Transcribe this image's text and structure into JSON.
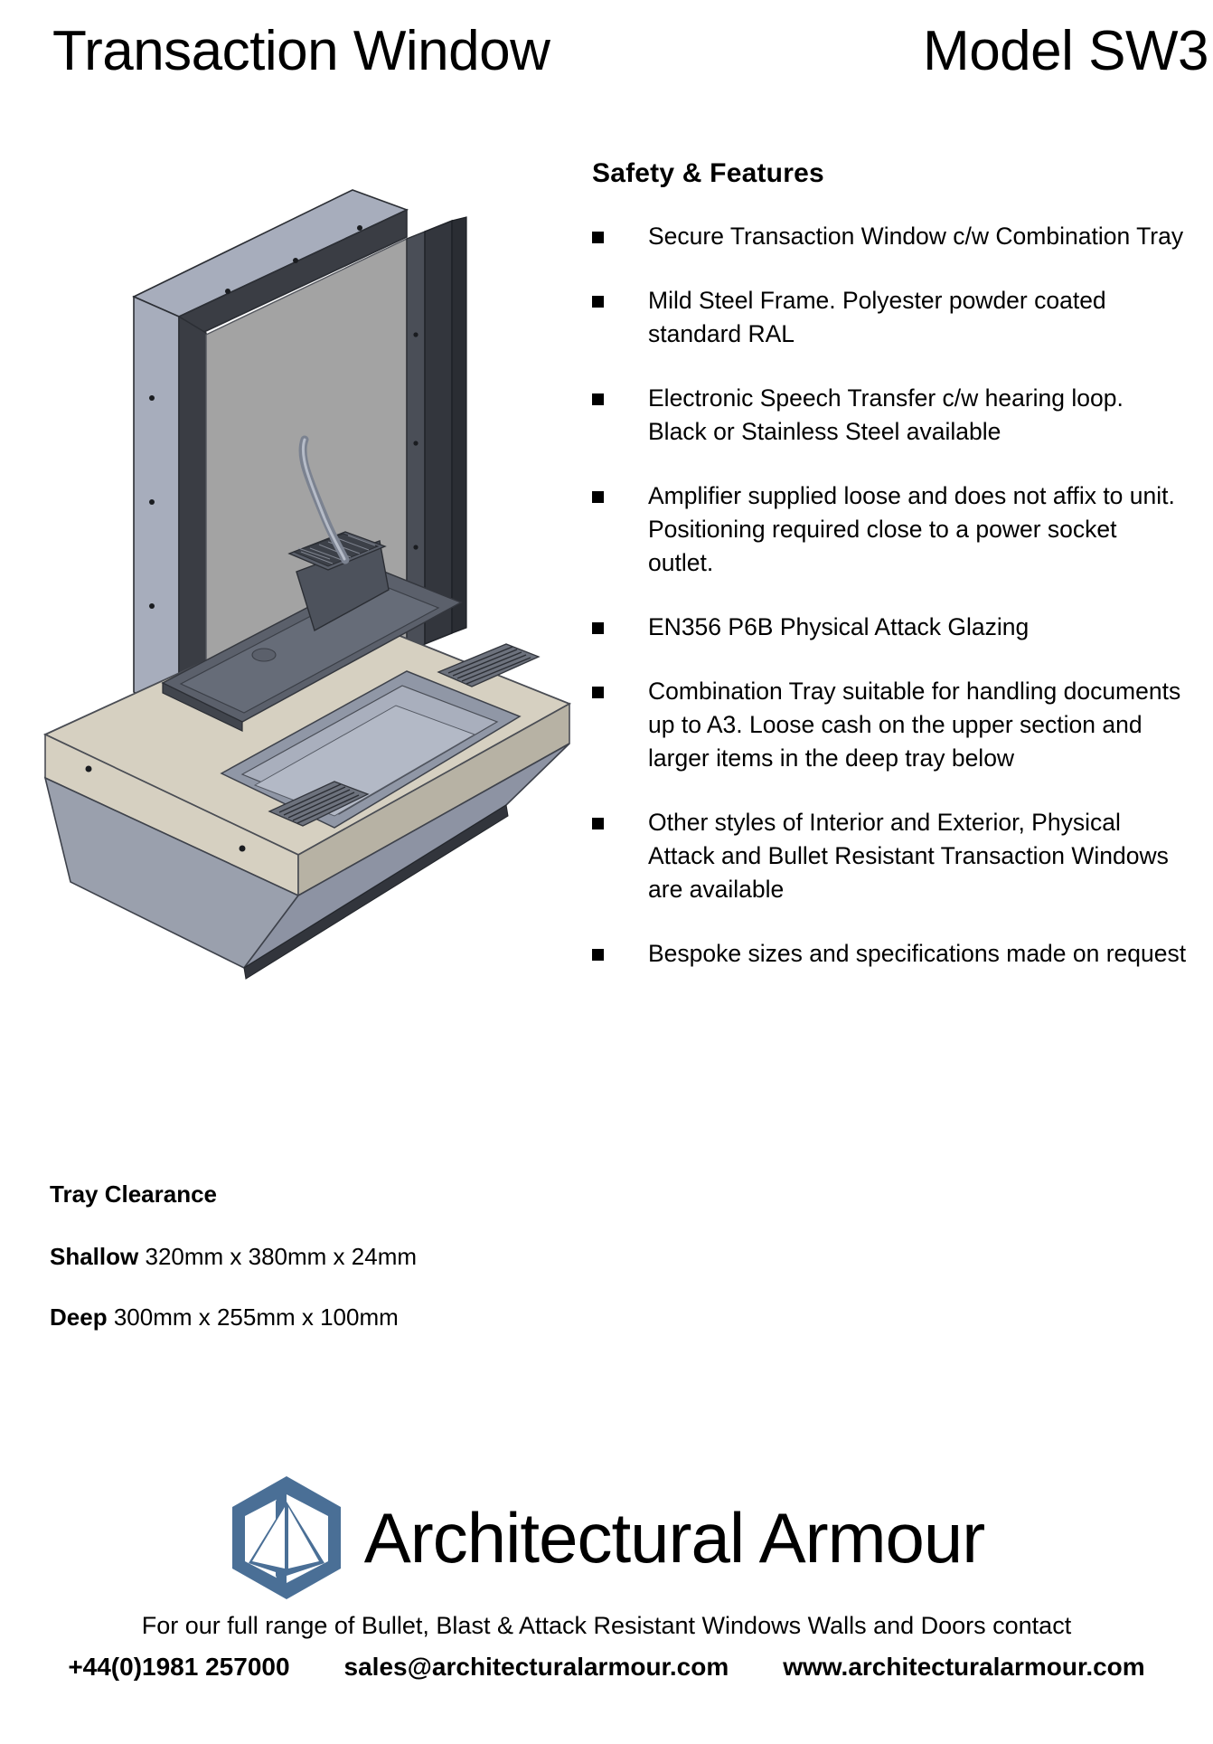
{
  "header": {
    "title": "Transaction Window",
    "model": "Model SW3"
  },
  "product_image": {
    "alt": "Isometric CAD render of Model SW3 secure transaction window with combination tray",
    "colors": {
      "frame_dark": "#3a3d44",
      "frame_light": "#a7adbc",
      "glass": "#a3a3a3",
      "counter_beige": "#d6d0c1",
      "tray_metal": "#8d93a3",
      "tray_dark": "#585d69",
      "apron": "#9aa0ad"
    }
  },
  "features": {
    "heading": "Safety & Features",
    "items": [
      "Secure Transaction Window c/w Combination Tray",
      "Mild Steel Frame. Polyester powder coated standard RAL",
      "Electronic Speech Transfer c/w hearing loop. Black or Stainless Steel available",
      "Amplifier supplied loose and does not affix to unit.  Positioning required close to a power socket outlet.",
      "EN356 P6B Physical Attack Glazing",
      "Combination Tray suitable for handling documents up to A3.  Loose cash on the upper section and larger items in the deep tray below",
      "Other styles of Interior and Exterior, Physical Attack and Bullet Resistant Transaction Windows are available",
      "Bespoke sizes and specifications made on request"
    ]
  },
  "tray_clearance": {
    "heading": "Tray Clearance",
    "rows": [
      {
        "label": "Shallow",
        "value": "320mm x 380mm x 24mm"
      },
      {
        "label": "Deep",
        "value": "300mm x 255mm x 100mm"
      }
    ]
  },
  "footer": {
    "brand_name": "Architectural Armour",
    "logo_color": "#4a6f96",
    "tagline": "For our full range of Bullet, Blast & Attack Resistant Windows Walls and Doors contact",
    "phone": "+44(0)1981 257000",
    "email": "sales@architecturalarmour.com",
    "website": "www.architecturalarmour.com"
  }
}
